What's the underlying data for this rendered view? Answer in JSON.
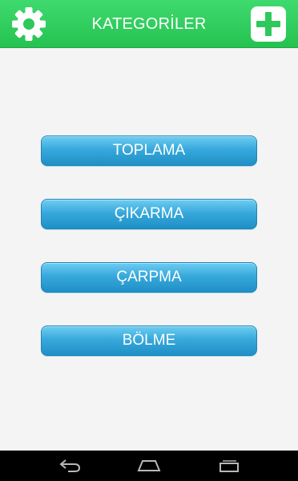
{
  "header": {
    "title": "KATEGORİLER",
    "settings_icon": "gear-icon",
    "add_icon": "plus-square-icon",
    "bar_color": "#2ecc5c"
  },
  "categories": [
    {
      "label": "TOPLAMA"
    },
    {
      "label": "ÇIKARMA"
    },
    {
      "label": "ÇARPMA"
    },
    {
      "label": "BÖLME"
    }
  ],
  "category_button_color": "#2a9fd6",
  "navigation": {
    "back_icon": "back-arrow-icon",
    "home_icon": "home-icon",
    "recents_icon": "recent-apps-icon"
  }
}
